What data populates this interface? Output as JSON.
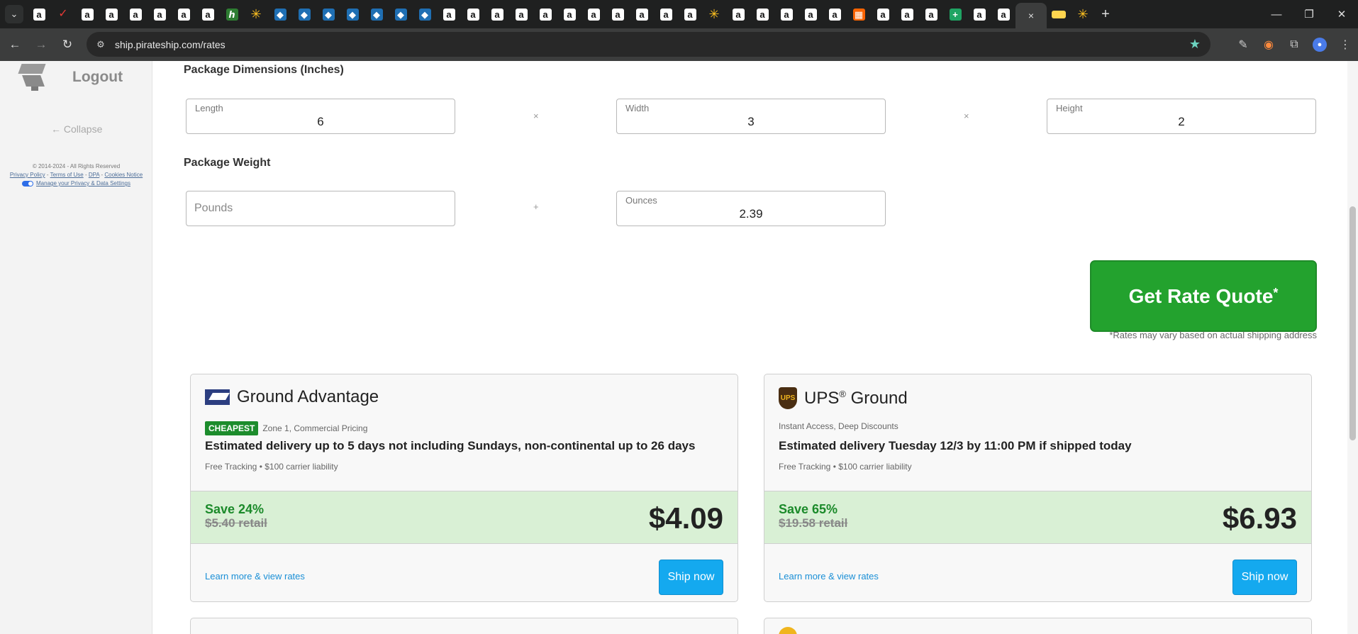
{
  "browser": {
    "url": "ship.pirateship.com/rates",
    "tabs": [
      {
        "type": "amazon"
      },
      {
        "type": "check"
      },
      {
        "type": "amazon"
      },
      {
        "type": "amazon"
      },
      {
        "type": "amazon"
      },
      {
        "type": "amazon"
      },
      {
        "type": "amazon"
      },
      {
        "type": "amazon"
      },
      {
        "type": "green"
      },
      {
        "type": "walmart"
      },
      {
        "type": "diamond"
      },
      {
        "type": "diamond"
      },
      {
        "type": "diamond"
      },
      {
        "type": "diamond"
      },
      {
        "type": "diamond"
      },
      {
        "type": "diamond"
      },
      {
        "type": "diamond"
      },
      {
        "type": "amazon"
      },
      {
        "type": "amazon"
      },
      {
        "type": "amazon"
      },
      {
        "type": "amazon"
      },
      {
        "type": "amazon"
      },
      {
        "type": "amazon"
      },
      {
        "type": "amazon"
      },
      {
        "type": "amazon"
      },
      {
        "type": "amazon"
      },
      {
        "type": "amazon"
      },
      {
        "type": "amazon"
      },
      {
        "type": "walmart"
      },
      {
        "type": "amazon"
      },
      {
        "type": "amazon"
      },
      {
        "type": "amazon"
      },
      {
        "type": "amazon"
      },
      {
        "type": "amazon"
      },
      {
        "type": "homedepot"
      },
      {
        "type": "amazon"
      },
      {
        "type": "amazon"
      },
      {
        "type": "amazon"
      },
      {
        "type": "sheets"
      },
      {
        "type": "amazon"
      },
      {
        "type": "amazon"
      }
    ],
    "active_tab_close": "×",
    "after_tabs": [
      {
        "type": "ups"
      },
      {
        "type": "walmart"
      }
    ],
    "new_tab": "+",
    "window_controls": {
      "minimize": "—",
      "restore": "❐",
      "close": "✕"
    }
  },
  "sidebar": {
    "logout_label": "Logout",
    "collapse_label": "← Collapse",
    "copyright": "© 2014-2024 - All Rights Reserved",
    "links": [
      "Privacy Policy",
      "Terms of Use",
      "DPA",
      "Cookies Notice"
    ],
    "privacy_settings": "Manage your Privacy & Data Settings"
  },
  "form": {
    "dimensions_title": "Package Dimensions (Inches)",
    "length": {
      "label": "Length",
      "value": "6"
    },
    "width": {
      "label": "Width",
      "value": "3"
    },
    "height": {
      "label": "Height",
      "value": "2"
    },
    "times": "×",
    "weight_title": "Package Weight",
    "pounds": {
      "placeholder": "Pounds"
    },
    "plus": "+",
    "ounces": {
      "label": "Ounces",
      "value": "2.39"
    },
    "quote_button": "Get Rate Quote",
    "quote_asterisk": "*",
    "quote_note": "*Rates may vary based on actual shipping address"
  },
  "rates": [
    {
      "carrier_logo": "usps-logo",
      "service": "Ground Advantage",
      "badge": "CHEAPEST",
      "subtitle": "Zone 1, Commercial Pricing",
      "delivery": "Estimated delivery up to 5 days not including Sundays, non-continental up to 26 days",
      "features": "Free Tracking • $100 carrier liability",
      "save": "Save 24%",
      "retail": "$5.40 retail",
      "price": "$4.09",
      "learn_more": "Learn more & view rates",
      "ship_now": "Ship now"
    },
    {
      "carrier_logo": "ups-logo",
      "logo_text": "UPS",
      "service": "UPS",
      "service_reg": "®",
      "service_suffix": " Ground",
      "subtitle": "Instant Access, Deep Discounts",
      "delivery": "Estimated delivery Tuesday 12/3 by 11:00 PM if shipped today",
      "features": "Free Tracking • $100 carrier liability",
      "save": "Save 65%",
      "retail": "$19.58 retail",
      "price": "$6.93",
      "learn_more": "Learn more & view rates",
      "ship_now": "Ship now"
    }
  ],
  "colors": {
    "accent_green": "#23a22e",
    "ship_blue": "#14a9ef",
    "save_band": "#d9f0d5",
    "link_blue": "#1a8fd6"
  }
}
